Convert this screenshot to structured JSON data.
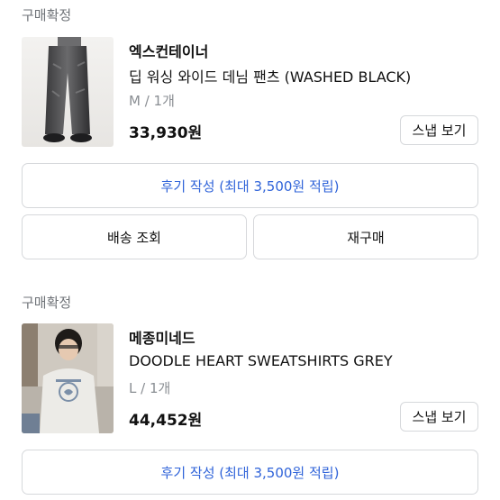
{
  "orders": [
    {
      "status": "구매확정",
      "brand": "엑스컨테이너",
      "product_name": "딥 워싱 와이드 데님 팬츠 (WASHED BLACK)",
      "option": "M / 1개",
      "price": "33,930원",
      "snap_button": "스냅 보기",
      "review_button": "후기 작성 (최대 3,500원 적립)",
      "shipping_button": "배송 조회",
      "rebuy_button": "재구매",
      "image": "jeans-product-photo"
    },
    {
      "status": "구매확정",
      "brand": "메종미네드",
      "product_name": "DOODLE HEART SWEATSHIRTS GREY",
      "option": "L / 1개",
      "price": "44,452원",
      "snap_button": "스냅 보기",
      "review_button": "후기 작성 (최대 3,500원 적립)",
      "image": "sweatshirt-product-photo"
    }
  ],
  "colors": {
    "accent_blue": "#2f63d9",
    "muted_text": "#6f7378",
    "border": "#d6d8db"
  }
}
